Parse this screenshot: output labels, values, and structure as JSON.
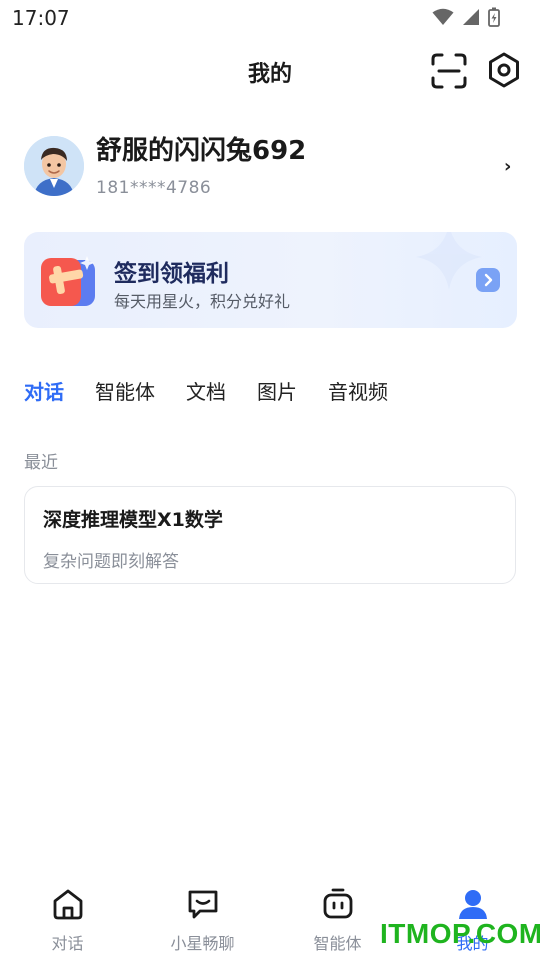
{
  "status_bar": {
    "time": "17:07"
  },
  "header": {
    "title": "我的"
  },
  "profile": {
    "username": "舒服的闪闪兔692",
    "phone": "181****4786",
    "chevron": "›"
  },
  "signin": {
    "title": "签到领福利",
    "subtitle": "每天用星火，积分兑好礼"
  },
  "tabs": [
    {
      "label": "对话"
    },
    {
      "label": "智能体"
    },
    {
      "label": "文档"
    },
    {
      "label": "图片"
    },
    {
      "label": "音视频"
    }
  ],
  "recent": {
    "section_label": "最近",
    "items": [
      {
        "title": "深度推理模型X1数学",
        "description": "复杂问题即刻解答"
      }
    ]
  },
  "bottom_nav": [
    {
      "label": "对话",
      "icon": "home-icon"
    },
    {
      "label": "小星畅聊",
      "icon": "chat-bubble-icon"
    },
    {
      "label": "智能体",
      "icon": "agent-icon"
    },
    {
      "label": "我的",
      "icon": "user-icon"
    }
  ],
  "watermark": "ITMOP.COM",
  "colors": {
    "accent": "#2f6cf6",
    "muted": "#8a8f99",
    "card_bg": "#e9effd"
  }
}
